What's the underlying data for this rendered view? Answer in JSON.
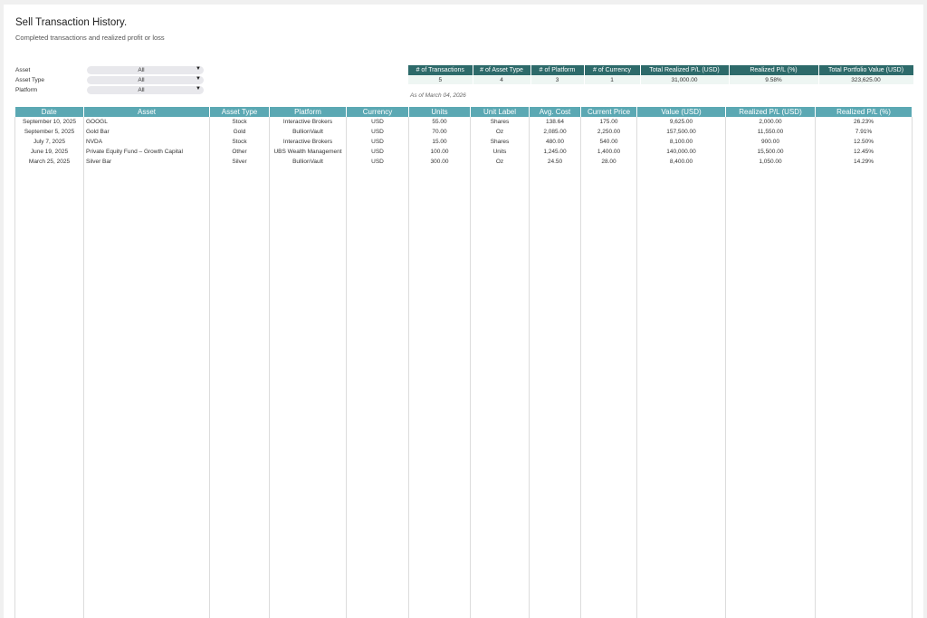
{
  "header": {
    "title": "Sell Transaction History.",
    "subtitle": "Completed transactions and realized profit or loss"
  },
  "filters": [
    {
      "label": "Asset",
      "value": "All"
    },
    {
      "label": "Asset Type",
      "value": "All"
    },
    {
      "label": "Platform",
      "value": "All"
    }
  ],
  "summary": {
    "headers": [
      "# of Transactions",
      "# of Asset Type",
      "# of Platform",
      "# of Currency",
      "Total Realized P/L (USD)",
      "Realized P/L (%)",
      "Total Portfolio Value (USD)"
    ],
    "values": [
      "5",
      "4",
      "3",
      "1",
      "31,000.00",
      "9.58%",
      "323,625.00"
    ],
    "as_of": "As of March 04, 2026",
    "header_color": "#2d6a6a"
  },
  "table": {
    "columns": [
      "Date",
      "Asset",
      "Asset Type",
      "Platform",
      "Currency",
      "Units",
      "Unit Label",
      "Avg. Cost",
      "Current Price",
      "Value (USD)",
      "Realized P/L (USD)",
      "Realized P/L (%)"
    ],
    "header_color": "#5ba8b3",
    "rows": [
      [
        "September 10, 2025",
        "GOOGL",
        "Stock",
        "Interactive Brokers",
        "USD",
        "55.00",
        "Shares",
        "138.64",
        "175.00",
        "9,625.00",
        "2,000.00",
        "26.23%"
      ],
      [
        "September 5, 2025",
        "Gold Bar",
        "Gold",
        "BullionVault",
        "USD",
        "70.00",
        "Oz",
        "2,085.00",
        "2,250.00",
        "157,500.00",
        "11,550.00",
        "7.91%"
      ],
      [
        "July 7, 2025",
        "NVDA",
        "Stock",
        "Interactive Brokers",
        "USD",
        "15.00",
        "Shares",
        "480.00",
        "540.00",
        "8,100.00",
        "900.00",
        "12.50%"
      ],
      [
        "June 19, 2025",
        "Private Equity Fund – Growth Capital",
        "Other",
        "UBS Wealth Management",
        "USD",
        "100.00",
        "Units",
        "1,245.00",
        "1,400.00",
        "140,000.00",
        "15,500.00",
        "12.45%"
      ],
      [
        "March 25, 2025",
        "Silver Bar",
        "Silver",
        "BullionVault",
        "USD",
        "300.00",
        "Oz",
        "24.50",
        "28.00",
        "8,400.00",
        "1,050.00",
        "14.29%"
      ]
    ]
  },
  "icons": {
    "dropdown": "caret-down-icon"
  }
}
